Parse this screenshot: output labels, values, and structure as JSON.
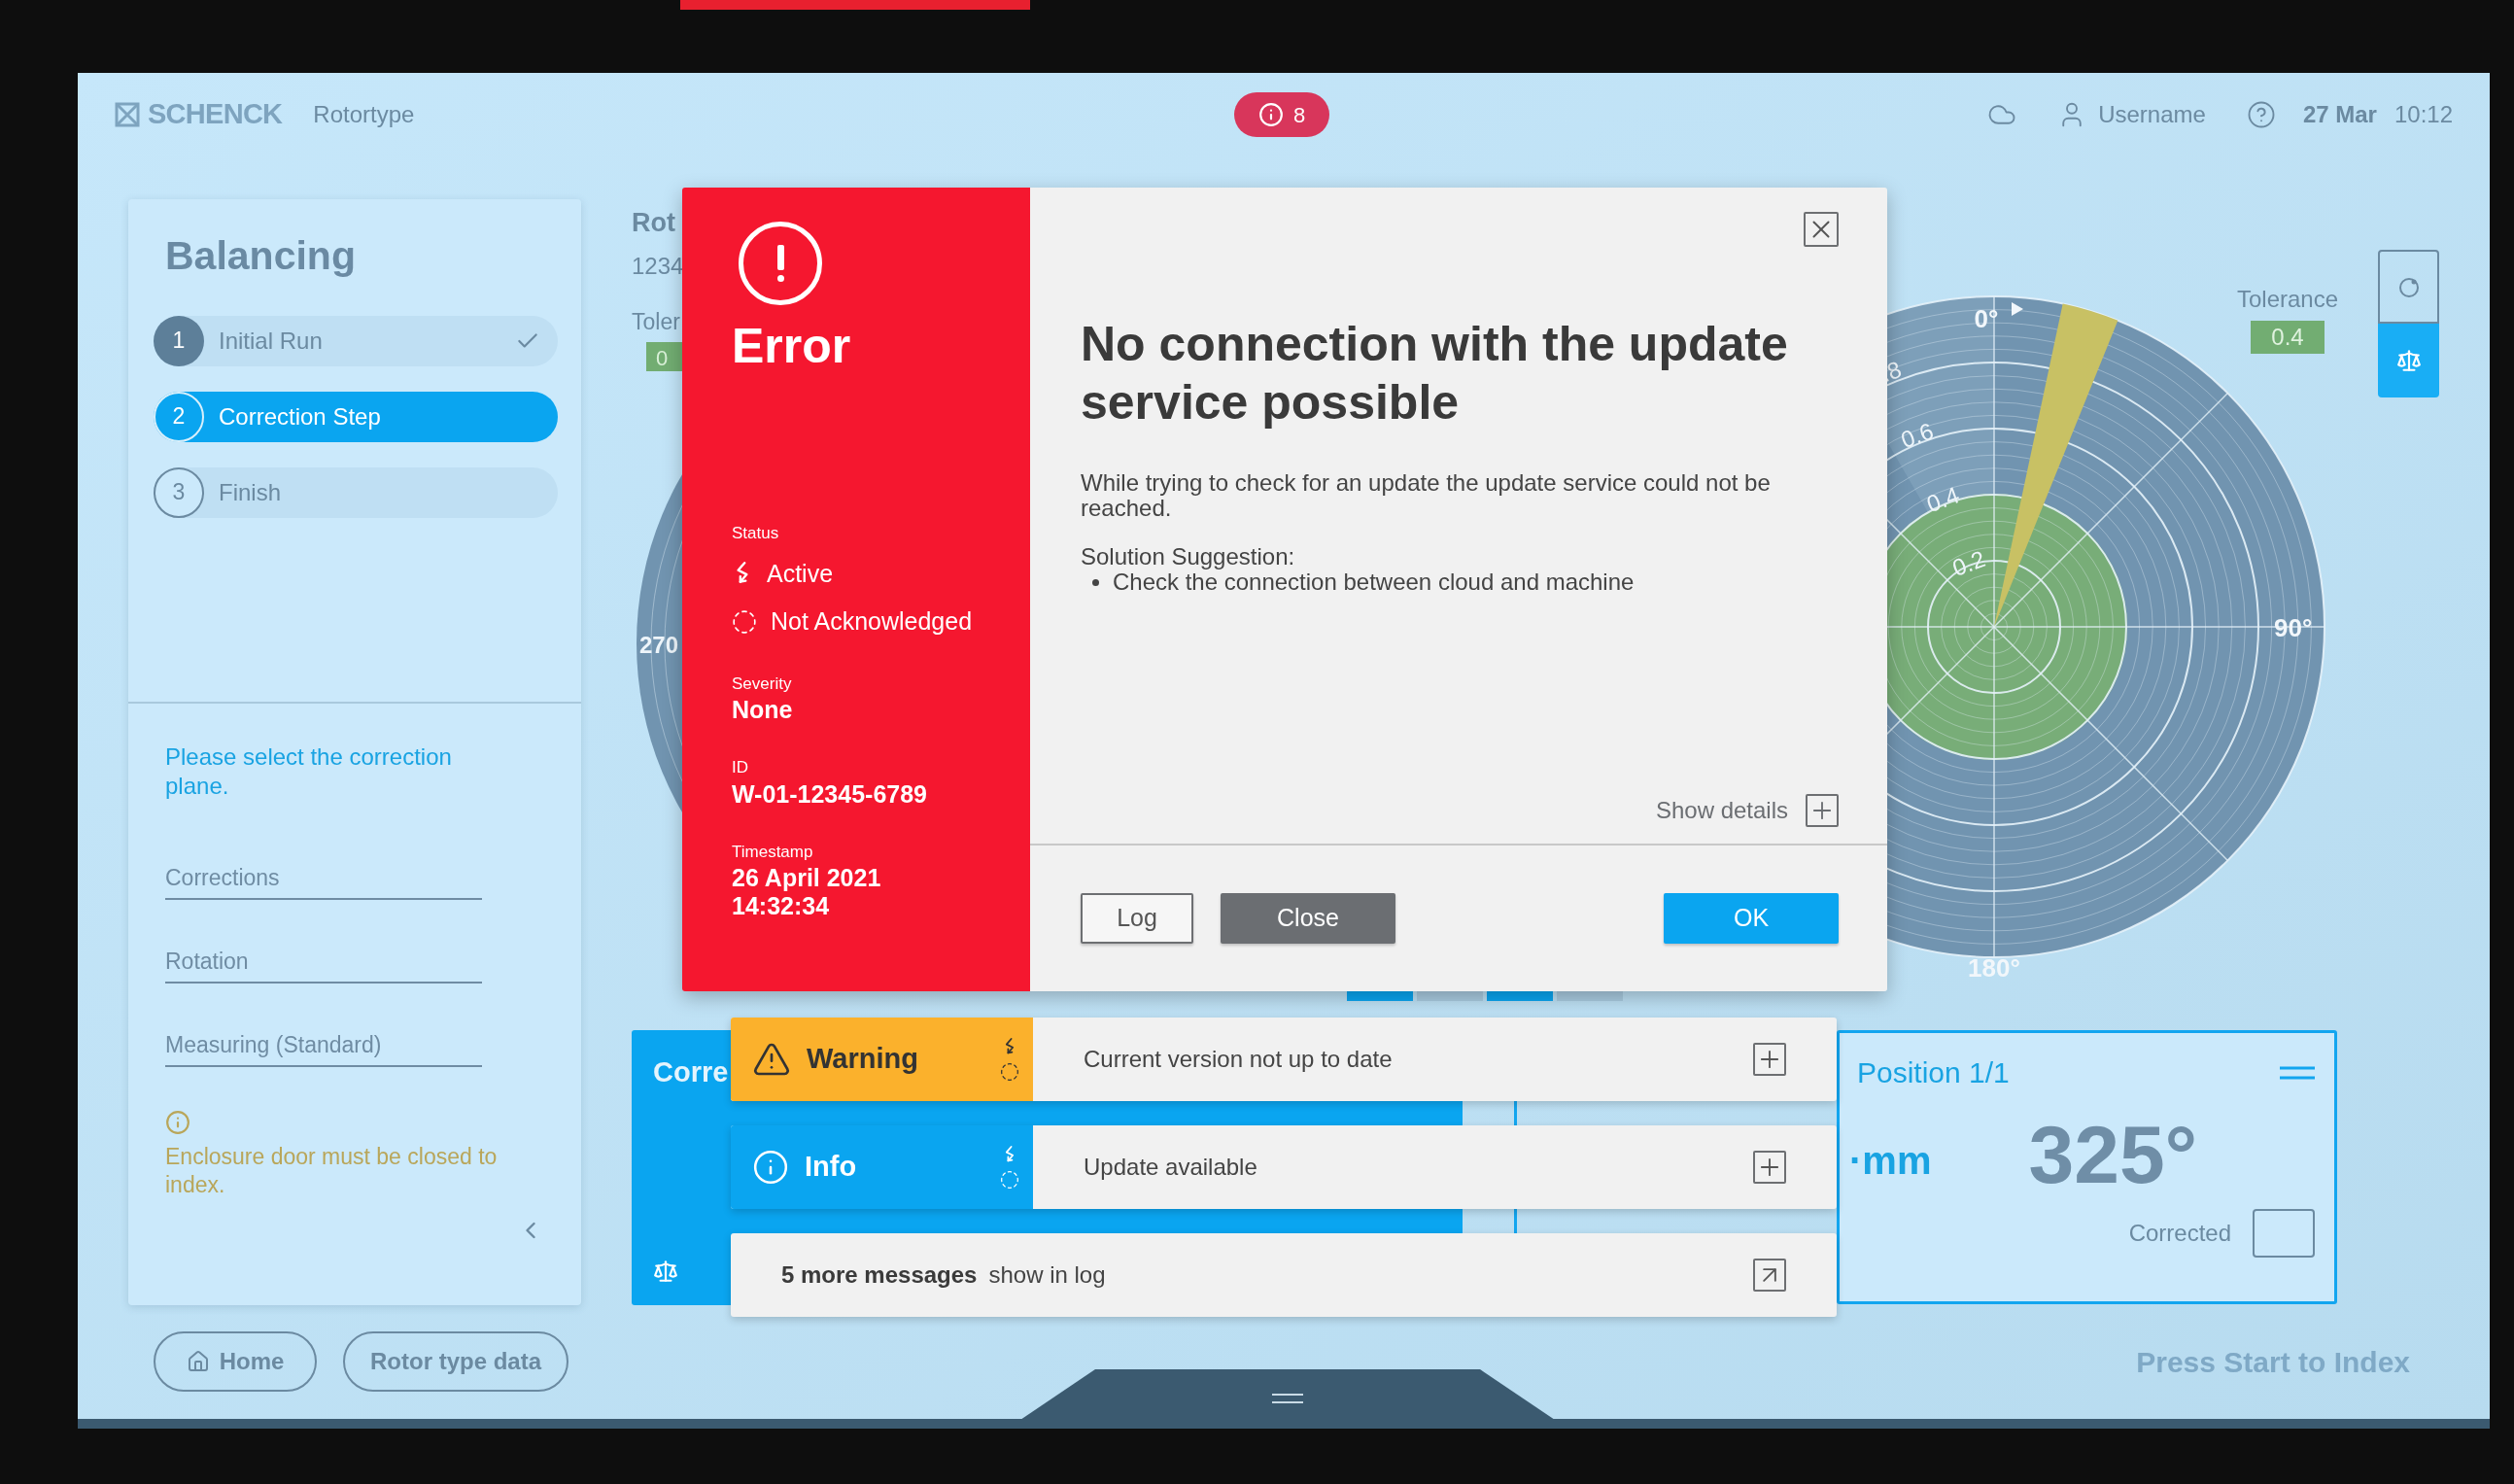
{
  "header": {
    "logo": "SCHENCK",
    "app": "Rotortype",
    "alert_count": "8",
    "user": "Username",
    "date": "27 Mar",
    "time": "10:12"
  },
  "sidebar": {
    "title": "Balancing",
    "steps": [
      {
        "number": "1",
        "label": "Initial Run",
        "checked": true,
        "selected": false
      },
      {
        "number": "2",
        "label": "Correction Step",
        "checked": false,
        "selected": true
      },
      {
        "number": "3",
        "label": "Finish",
        "checked": false,
        "selected": false
      }
    ],
    "instruction": "Please select the correction plane.",
    "fields": [
      {
        "placeholder": "Corrections"
      },
      {
        "placeholder": "Rotation"
      },
      {
        "placeholder": "Measuring (Standard)"
      }
    ],
    "notice": "Enclosure door must be closed to index."
  },
  "footer_buttons": [
    "Home",
    "Rotor type data"
  ],
  "footer_hint": "Press Start to Index",
  "rotor": {
    "title": "Rot",
    "number": "1234",
    "tolerance_label": "Toler",
    "tolerance_value": "0",
    "chart_label": "270"
  },
  "polar_chart": {
    "angle_labels": [
      "0°",
      "90°",
      "180°"
    ],
    "radius_labels": [
      "0.2",
      "0.4",
      "0.6",
      ".8"
    ]
  },
  "tolerance": {
    "label": "Tolerance",
    "value": "0.4"
  },
  "view_toggle": [
    {
      "selected": false
    },
    {
      "selected": true
    }
  ],
  "segments": [
    {
      "selected": true
    },
    {
      "selected": false
    },
    {
      "selected": true
    },
    {
      "selected": false
    }
  ],
  "correction_card": {
    "title": "Corre"
  },
  "position_card": {
    "title": "Position 1/1",
    "unit": "·mm",
    "angle": "325°",
    "corrected_label": "Corrected",
    "corrected": false
  },
  "dialog": {
    "kind": "error",
    "label": "Error",
    "status_label": "Status",
    "statuses": [
      {
        "kind": "active",
        "label": "Active"
      },
      {
        "kind": "unacknowledged",
        "label": "Not Acknowledged"
      }
    ],
    "fields": [
      {
        "label": "Severity",
        "lines": [
          "None"
        ]
      },
      {
        "label": "ID",
        "lines": [
          "W-01-12345-6789"
        ]
      },
      {
        "label": "Timestamp",
        "lines": [
          "26 April 2021",
          "14:32:34"
        ]
      }
    ],
    "heading": "No connection with the update service possible",
    "description": "While trying to check for an update the update service could not be reached.",
    "solution_label": "Solution Suggestion:",
    "solution_items": [
      "Check the connection between cloud and machine"
    ],
    "show_details": "Show details",
    "buttons": [
      {
        "kind": "outline",
        "label": "Log"
      },
      {
        "kind": "secondary",
        "label": "Close"
      },
      {
        "kind": "primary",
        "label": "OK"
      }
    ]
  },
  "notifications": [
    {
      "kind": "warning",
      "label": "Warning",
      "message": "Current version not up to date"
    },
    {
      "kind": "info",
      "label": "Info",
      "message": "Update available"
    }
  ],
  "more_messages": {
    "count": "5 more messages",
    "link": "show in log"
  }
}
